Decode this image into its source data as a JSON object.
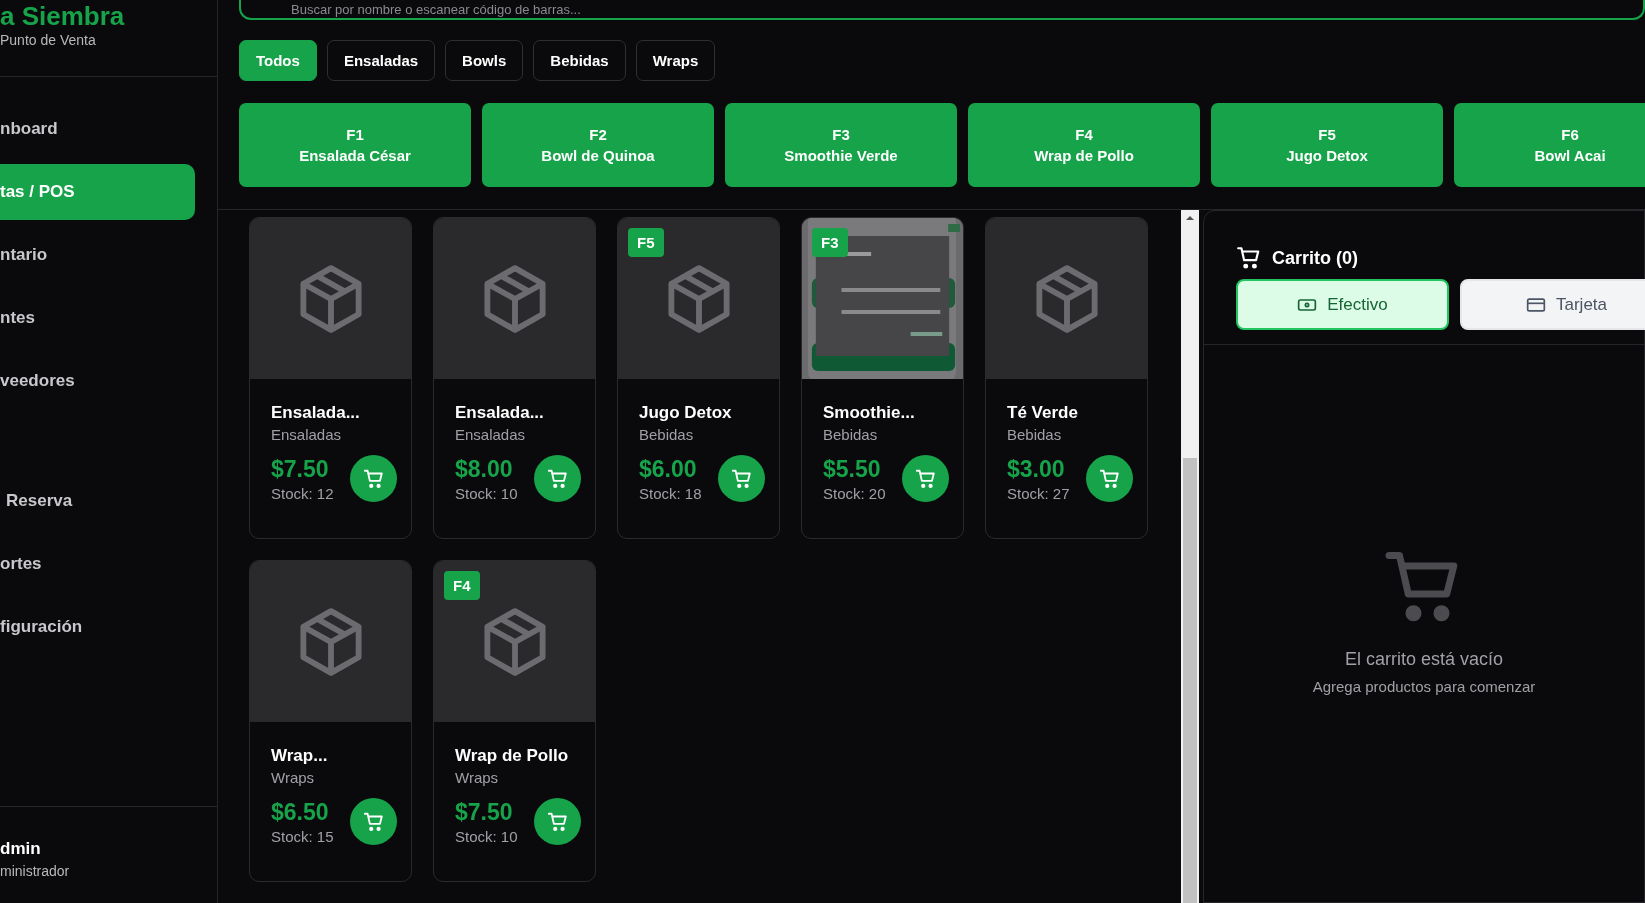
{
  "sidebar": {
    "brand": "a Siembra",
    "subtitle": "Punto de Venta",
    "items": [
      {
        "label": "nboard",
        "selected": false
      },
      {
        "label": "tas / POS",
        "selected": true
      },
      {
        "label": "ntario",
        "selected": false
      },
      {
        "label": "ntes",
        "selected": false
      },
      {
        "label": "veedores",
        "selected": false
      },
      {
        "label": "Reserva",
        "selected": false
      },
      {
        "label": "ortes",
        "selected": false
      },
      {
        "label": "figuración",
        "selected": false
      }
    ],
    "user": {
      "name": "dmin",
      "role": "ministrador"
    }
  },
  "search": {
    "placeholder": "Buscar por nombre o escanear código de barras..."
  },
  "filters": [
    {
      "label": "Todos",
      "selected": true
    },
    {
      "label": "Ensaladas",
      "selected": false
    },
    {
      "label": "Bowls",
      "selected": false
    },
    {
      "label": "Bebidas",
      "selected": false
    },
    {
      "label": "Wraps",
      "selected": false
    }
  ],
  "shortcuts": [
    {
      "key": "F1",
      "name": "Ensalada César"
    },
    {
      "key": "F2",
      "name": "Bowl de Quinoa"
    },
    {
      "key": "F3",
      "name": "Smoothie Verde"
    },
    {
      "key": "F4",
      "name": "Wrap de Pollo"
    },
    {
      "key": "F5",
      "name": "Jugo Detox"
    },
    {
      "key": "F6",
      "name": "Bowl Acai"
    }
  ],
  "products": [
    {
      "name": "Ensalada...",
      "category": "Ensaladas",
      "price": "$7.50",
      "stock": "Stock: 12"
    },
    {
      "name": "Ensalada...",
      "category": "Ensaladas",
      "price": "$8.00",
      "stock": "Stock: 10"
    },
    {
      "badge": "F5",
      "name": "Jugo Detox",
      "category": "Bebidas",
      "price": "$6.00",
      "stock": "Stock: 18"
    },
    {
      "badge": "F3",
      "name": "Smoothie...",
      "category": "Bebidas",
      "price": "$5.50",
      "stock": "Stock: 20",
      "kind": "picture"
    },
    {
      "name": "Té Verde",
      "category": "Bebidas",
      "price": "$3.00",
      "stock": "Stock: 27"
    },
    {
      "name": "Wrap...",
      "category": "Wraps",
      "price": "$6.50",
      "stock": "Stock: 15"
    },
    {
      "badge": "F4",
      "name": "Wrap de Pollo",
      "category": "Wraps",
      "price": "$7.50",
      "stock": "Stock: 10"
    }
  ],
  "cart": {
    "title": "Carrito (0)",
    "payments": [
      {
        "label": "Efectivo",
        "kind": "cash",
        "selected": true
      },
      {
        "label": "Tarjeta",
        "kind": "card",
        "selected": false
      }
    ],
    "empty_title": "El carrito está vacío",
    "empty_hint": "Agrega productos para comenzar"
  }
}
